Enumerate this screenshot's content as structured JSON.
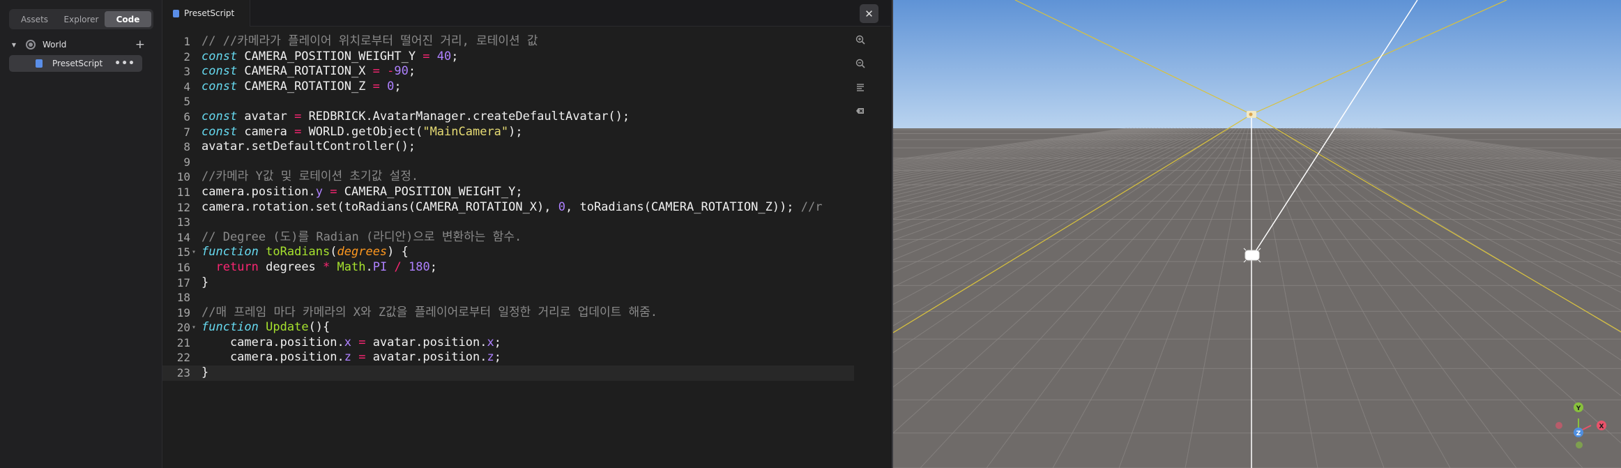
{
  "sidebar": {
    "tabs": [
      {
        "label": "Assets",
        "active": false
      },
      {
        "label": "Explorer",
        "active": false
      },
      {
        "label": "Code",
        "active": true
      }
    ],
    "tree": {
      "world_label": "World",
      "script_label": "PresetScript",
      "add_icon": "plus-icon",
      "menu_icon": "more-icon"
    }
  },
  "editor": {
    "tab_label": "PresetScript",
    "close_icon": "close-icon",
    "current_line": 23,
    "tools": [
      "zoom-in-icon",
      "zoom-out-icon",
      "list-icon",
      "clear-icon"
    ]
  },
  "code_lines": [
    "// //카메라가 플레이어 위치로부터 떨어진 거리, 로테이션 값",
    "const CAMERA_POSITION_WEIGHT_Y = 40;",
    "const CAMERA_ROTATION_X = -90;",
    "const CAMERA_ROTATION_Z = 0;",
    "",
    "const avatar = REDBRICK.AvatarManager.createDefaultAvatar();",
    "const camera = WORLD.getObject(\"MainCamera\");",
    "avatar.setDefaultController();",
    "",
    "//카메라 Y값 및 로테이션 초기값 설정.",
    "camera.position.y = CAMERA_POSITION_WEIGHT_Y;",
    "camera.rotation.set(toRadians(CAMERA_ROTATION_X), 0, toRadians(CAMERA_ROTATION_Z)); //r",
    "",
    "// Degree (도)를 Radian (라디안)으로 변환하는 함수.",
    "function toRadians(degrees) {",
    "  return degrees * Math.PI / 180;",
    "}",
    "",
    "//매 프레임 마다 카메라의 X와 Z값을 플레이어로부터 일정한 거리로 업데이트 해줌.",
    "function Update(){",
    "    camera.position.x = avatar.position.x;",
    "    camera.position.z = avatar.position.z;",
    "}"
  ],
  "viewport": {
    "sky_top": "#5f93d6",
    "sky_bottom": "#b9d3ef",
    "floor": "#6f6b69",
    "grid_line": "#8c8886",
    "frustum_line": "#d9c23c",
    "axis_gizmo": {
      "x_label": "X",
      "y_label": "Y",
      "z_label": "Z",
      "x_color": "#e8526a",
      "y_color": "#88c13d",
      "z_color": "#4f8fe0"
    }
  }
}
